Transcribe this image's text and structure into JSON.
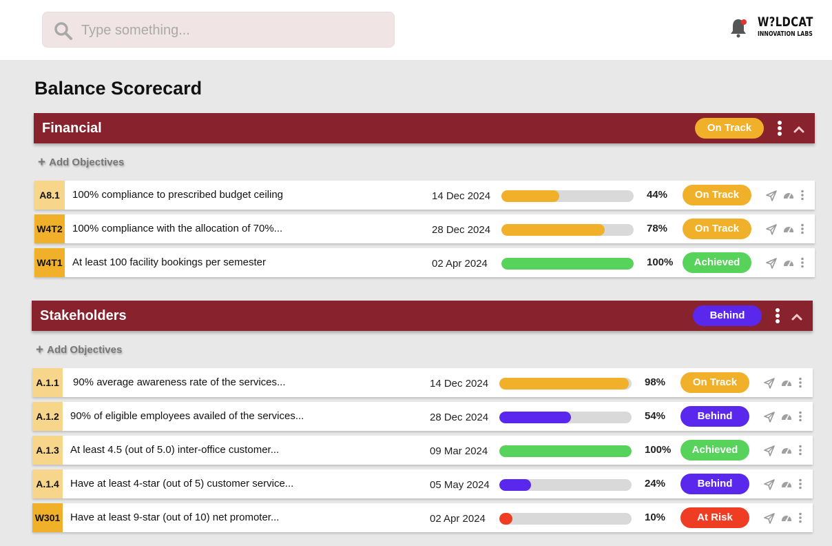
{
  "search": {
    "placeholder": "Type something...",
    "value": ""
  },
  "logo": {
    "line1": "W?LDCAT",
    "line2": "INNOVATION LABS"
  },
  "page_title": "Balance Scorecard",
  "colors": {
    "on_track": "#f0b02a",
    "achieved": "#57d35b",
    "behind": "#5a28ec",
    "at_risk": "#ee3d23",
    "header": "#88232d",
    "code_light": "#f7d58a",
    "code_dark": "#f0b02a"
  },
  "sections": [
    {
      "title": "Financial",
      "status": "On Track",
      "status_kind": "on_track",
      "add_label": "Add Objectives",
      "rows": [
        {
          "code": "A8.1",
          "code_style": "light",
          "text": "100% compliance to prescribed budget ceiling",
          "date": "14 Dec 2024",
          "progress": 44,
          "pct": "44%",
          "status": "On Track",
          "status_kind": "on_track"
        },
        {
          "code": "W4T2",
          "code_style": "dark",
          "text": "100% compliance with the allocation of 70%...",
          "date": "28 Dec 2024",
          "progress": 78,
          "pct": "78%",
          "status": "On Track",
          "status_kind": "on_track"
        },
        {
          "code": "W4T1",
          "code_style": "dark",
          "text": "At least 100 facility bookings per semester",
          "date": "02 Apr 2024",
          "progress": 100,
          "pct": "100%",
          "status": "Achieved",
          "status_kind": "achieved"
        }
      ]
    },
    {
      "title": "Stakeholders",
      "status": "Behind",
      "status_kind": "behind",
      "add_label": "Add Objectives",
      "rows": [
        {
          "code": "A.1.1",
          "code_style": "light",
          "text": "90% average awareness rate of the services...",
          "date": "14 Dec 2024",
          "progress": 98,
          "pct": "98%",
          "status": "On Track",
          "status_kind": "on_track"
        },
        {
          "code": "A.1.2",
          "code_style": "light",
          "text": "90% of eligible employees availed of the services...",
          "date": "28 Dec 2024",
          "progress": 54,
          "pct": "54%",
          "status": "Behind",
          "status_kind": "behind"
        },
        {
          "code": "A.1.3",
          "code_style": "light",
          "text": "At least 4.5 (out of 5.0) inter-office customer...",
          "date": "09 Mar 2024",
          "progress": 100,
          "pct": "100%",
          "status": "Achieved",
          "status_kind": "achieved"
        },
        {
          "code": "A.1.4",
          "code_style": "light",
          "text": "Have at least 4-star (out of 5) customer service...",
          "date": "05 May 2024",
          "progress": 24,
          "pct": "24%",
          "status": "Behind",
          "status_kind": "behind"
        },
        {
          "code": "W301",
          "code_style": "dark",
          "text": "Have at least 9-star (out of 10) net promoter...",
          "date": "02 Apr 2024",
          "progress": 10,
          "pct": "10%",
          "status": "At Risk",
          "status_kind": "at_risk"
        }
      ]
    }
  ]
}
